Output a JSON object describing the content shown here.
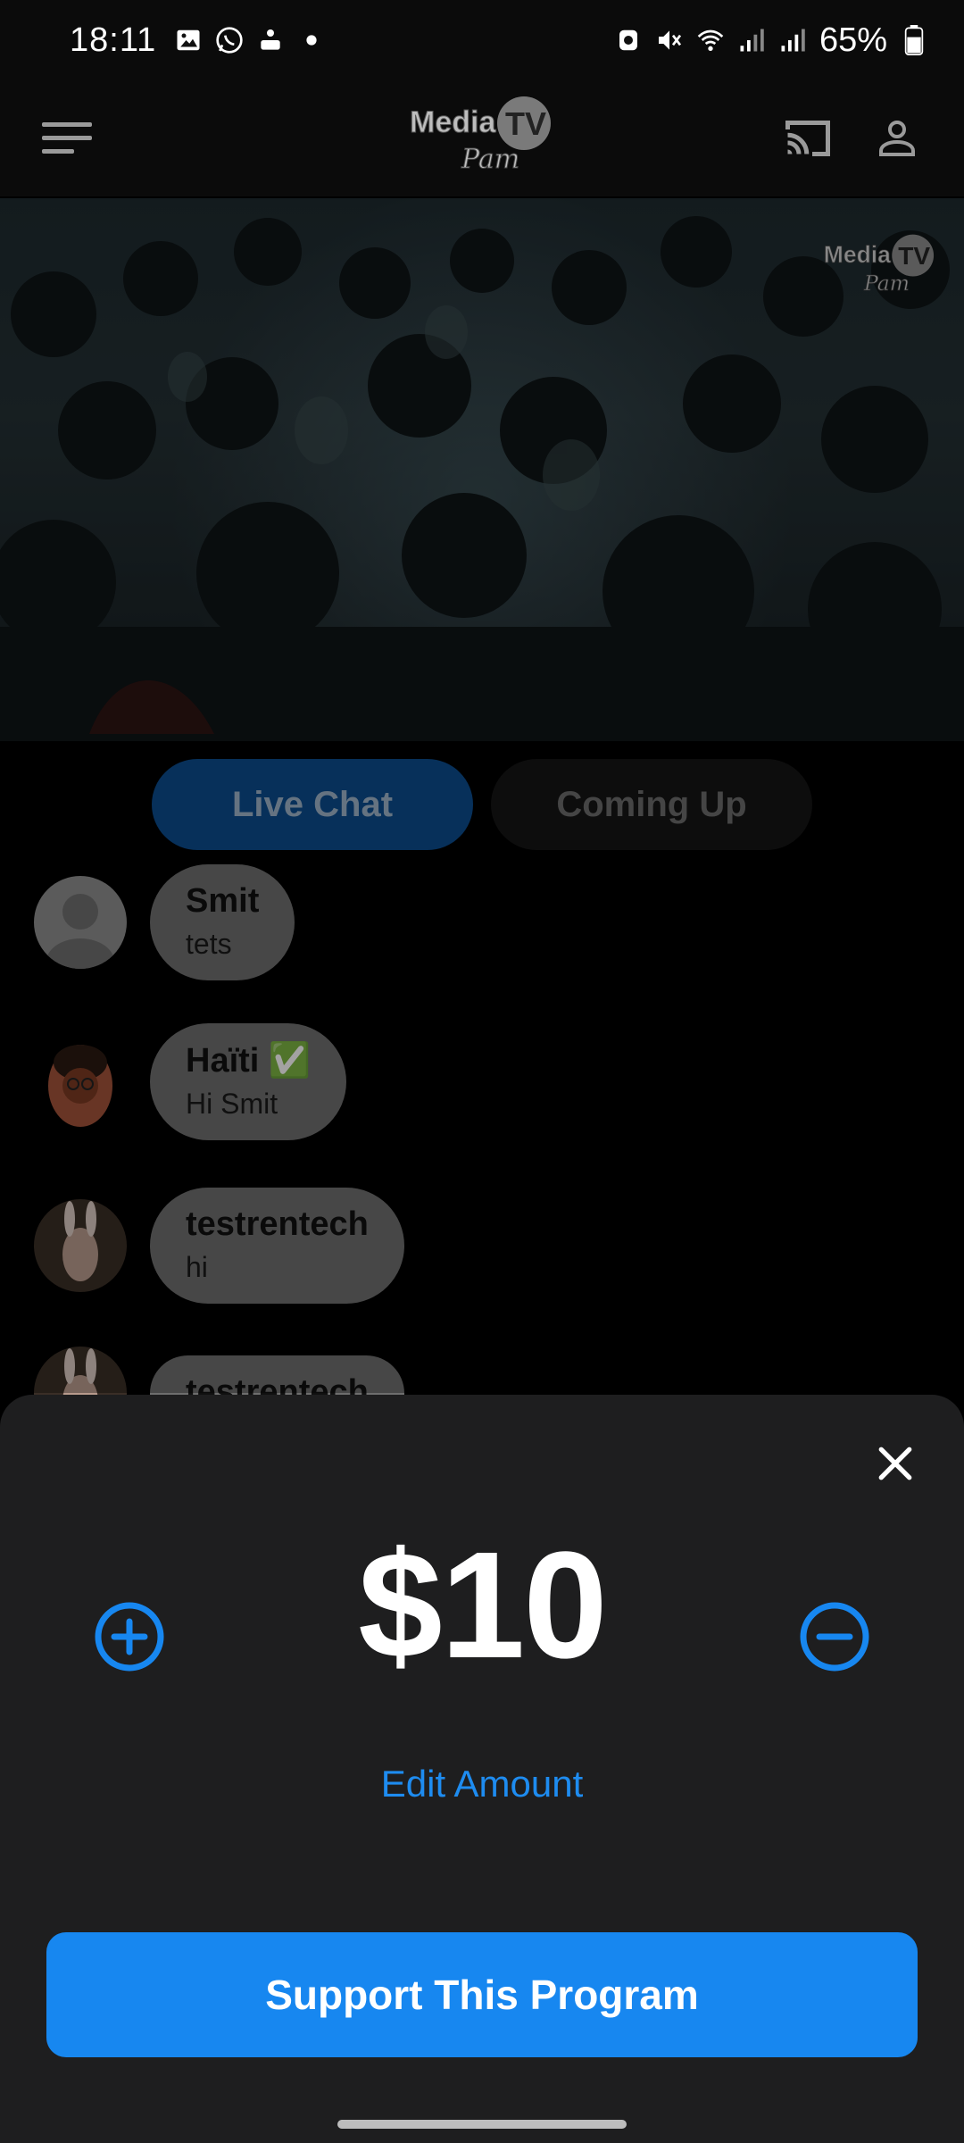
{
  "status_bar": {
    "time": "18:11",
    "battery": "65%",
    "icons_left": [
      "gallery-icon",
      "whatsapp-icon",
      "news-app-icon",
      "dot-icon"
    ],
    "icons_right": [
      "alarm-icon",
      "mute-icon",
      "wifi-icon",
      "signal-icon",
      "signal-icon",
      "battery-icon"
    ]
  },
  "app_bar": {
    "logo_main": "Media",
    "logo_tv": "TV",
    "logo_sub": "Pam"
  },
  "video": {
    "watermark_main": "Media",
    "watermark_tv": "TV",
    "watermark_sub": "Pam"
  },
  "tabs": [
    {
      "label": "Live Chat",
      "active": true
    },
    {
      "label": "Coming Up",
      "active": false
    }
  ],
  "chat": {
    "messages": [
      {
        "name": "Smit",
        "text": "tets"
      },
      {
        "name": "Haïti ✅",
        "text": "Hi Smit"
      },
      {
        "name": "testrentech",
        "text": "hi"
      },
      {
        "name": "testrentech",
        "text": ""
      }
    ]
  },
  "donation": {
    "amount": "$10",
    "edit_label": "Edit Amount",
    "support_label": "Support This Program"
  },
  "colors": {
    "accent": "#1787f0",
    "link": "#1e8cf0",
    "sheet_bg": "#1e1e1f"
  }
}
